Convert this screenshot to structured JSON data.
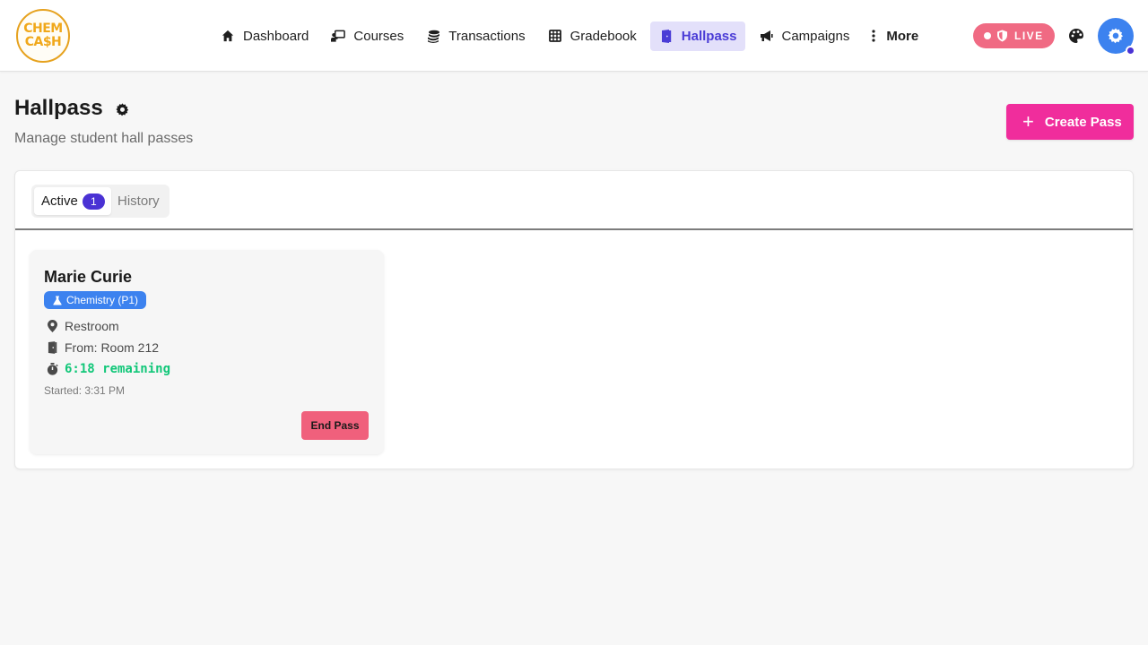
{
  "brand": {
    "logo_line1": "CHEM",
    "logo_line2": "CA$H"
  },
  "nav": {
    "items": [
      {
        "label": "Dashboard",
        "icon": "home-icon"
      },
      {
        "label": "Courses",
        "icon": "chalkboard-teacher-icon"
      },
      {
        "label": "Transactions",
        "icon": "coins-icon"
      },
      {
        "label": "Gradebook",
        "icon": "table-grid-icon"
      },
      {
        "label": "Hallpass",
        "icon": "door-icon",
        "active": true
      },
      {
        "label": "Campaigns",
        "icon": "bullhorn-icon"
      },
      {
        "label": "More",
        "icon": "vertical-dots-icon"
      }
    ]
  },
  "status": {
    "live_label": "LIVE"
  },
  "page": {
    "title": "Hallpass",
    "subtitle": "Manage student hall passes",
    "create_button_label": "Create Pass"
  },
  "tabs": {
    "active_label": "Active",
    "active_count": "1",
    "history_label": "History"
  },
  "passes": [
    {
      "student_name": "Marie Curie",
      "course": "Chemistry (P1)",
      "destination": "Restroom",
      "from": "From: Room 212",
      "remaining": "6:18 remaining",
      "started": "Started: 3:31 PM",
      "end_button_label": "End Pass"
    }
  ],
  "colors": {
    "accent": "#4a32d4",
    "active_nav_bg": "#e3e0fa",
    "create_button": "#f02d9c",
    "live_badge": "#f06a83",
    "course_badge": "#3c82ef",
    "timer_green": "#12c779",
    "end_button": "#f0607c",
    "logo_gold": "#f0a81b"
  }
}
